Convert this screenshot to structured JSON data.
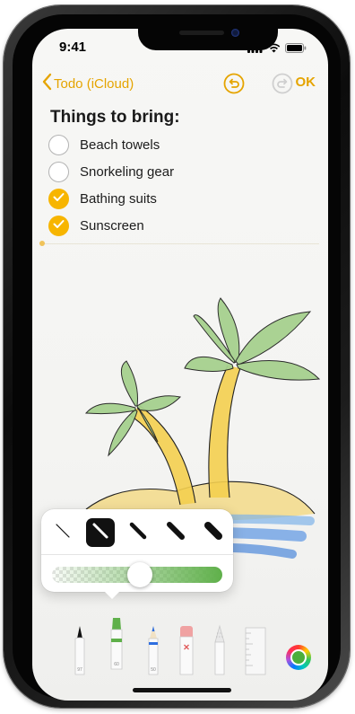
{
  "status_bar": {
    "time": "9:41"
  },
  "nav": {
    "back_label": "Todo (iCloud)",
    "ok_label": "OK"
  },
  "note": {
    "title": "Things to bring:",
    "items": [
      {
        "label": "Beach towels",
        "checked": false
      },
      {
        "label": "Snorkeling gear",
        "checked": false
      },
      {
        "label": "Bathing suits",
        "checked": true
      },
      {
        "label": "Sunscreen",
        "checked": true
      }
    ]
  },
  "tool_popover": {
    "selected_width_index": 1,
    "opacity_level": 0.52,
    "slider_color": "#5fb04a"
  },
  "palette": {
    "tools": [
      {
        "name": "pen",
        "label": "97"
      },
      {
        "name": "marker",
        "label": "60"
      },
      {
        "name": "pencil",
        "label": "50"
      },
      {
        "name": "eraser",
        "label": ""
      },
      {
        "name": "lasso",
        "label": ""
      },
      {
        "name": "ruler",
        "label": ""
      }
    ],
    "selected_tool": "marker",
    "current_color": "#4cae3c"
  },
  "colors": {
    "accent": "#e5a400",
    "check": "#f7b500"
  }
}
